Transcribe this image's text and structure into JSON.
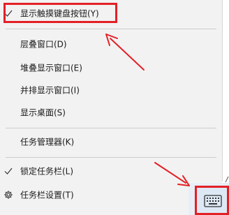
{
  "context_menu": {
    "items": [
      {
        "label": "显示触摸键盘按钮(Y)",
        "checked": true
      },
      {
        "label": "层叠窗口(D)"
      },
      {
        "label": "堆叠显示窗口(E)"
      },
      {
        "label": "并排显示窗口(I)"
      },
      {
        "label": "显示桌面(S)"
      },
      {
        "label": "任务管理器(K)"
      },
      {
        "label": "锁定任务栏(L)",
        "checked": true
      },
      {
        "label": "任务栏设置(T)",
        "icon": "gear-icon"
      }
    ]
  },
  "taskbar": {
    "touch_keyboard_button": {
      "icon": "keyboard-icon"
    }
  },
  "annotations": {
    "color": "#e32026"
  }
}
